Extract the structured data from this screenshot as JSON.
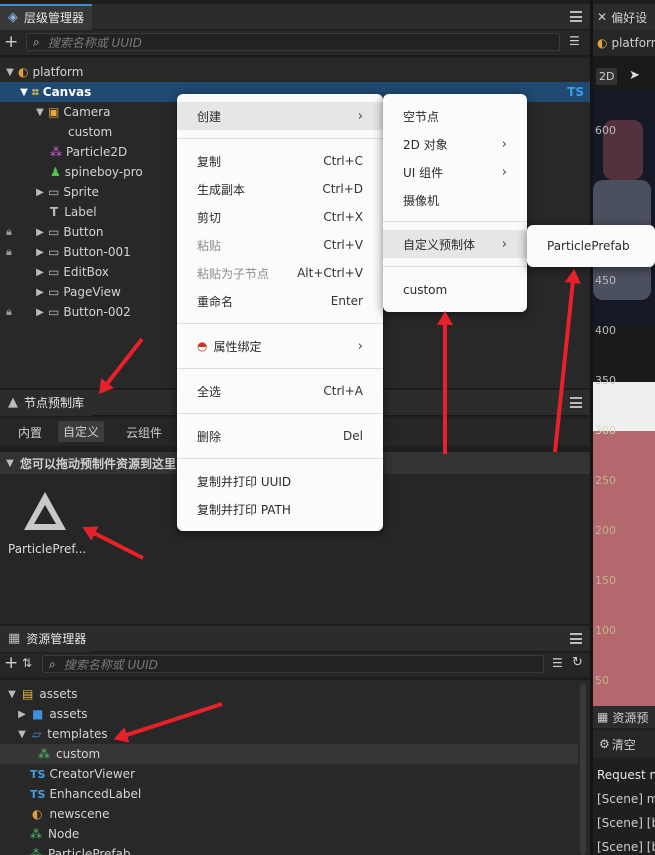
{
  "hierarchy": {
    "title": "层级管理器",
    "search_placeholder": "搜索名称或 UUID",
    "nodes": [
      {
        "label": "platform",
        "icon": "scene-icon"
      },
      {
        "label": "Canvas",
        "badge": "TS"
      },
      {
        "label": "Camera"
      },
      {
        "label": "custom"
      },
      {
        "label": "Particle2D"
      },
      {
        "label": "spineboy-pro"
      },
      {
        "label": "Sprite"
      },
      {
        "label": "Label"
      },
      {
        "label": "Button"
      },
      {
        "label": "Button-001"
      },
      {
        "label": "EditBox"
      },
      {
        "label": "PageView"
      },
      {
        "label": "Button-002"
      }
    ]
  },
  "prefab_lib": {
    "title": "节点预制库",
    "tabs": [
      "内置",
      "自定义",
      "云组件"
    ],
    "active_tab": "自定义",
    "section": "您可以拖动预制件资源到这里",
    "item_label": "ParticlePref..."
  },
  "assets": {
    "title": "资源管理器",
    "search_placeholder": "搜索名称或 UUID",
    "items": [
      {
        "label": "assets"
      },
      {
        "label": "assets"
      },
      {
        "label": "templates"
      },
      {
        "label": "custom"
      },
      {
        "label": "CreatorViewer",
        "prefix": "TS"
      },
      {
        "label": "EnhancedLabel",
        "prefix": "TS"
      },
      {
        "label": "newscene"
      },
      {
        "label": "Node"
      },
      {
        "label": "ParticlePrefab"
      }
    ]
  },
  "right": {
    "pref_tab": "偏好设",
    "scene_tab": "platform",
    "btn_2d": "2D",
    "ruler": [
      "600",
      "450",
      "400",
      "350",
      "300",
      "250",
      "200",
      "150",
      "100",
      "50"
    ],
    "console_title": "资源预",
    "clear_label": "清空",
    "rows": [
      "Request na",
      "[Scene] me",
      "[Scene] [bu",
      "[Scene] [bo"
    ]
  },
  "context_menu": {
    "items": [
      {
        "label": "创建",
        "shortcut": ""
      },
      {
        "label": "复制",
        "shortcut": "Ctrl+C"
      },
      {
        "label": "生成副本",
        "shortcut": "Ctrl+D"
      },
      {
        "label": "剪切",
        "shortcut": "Ctrl+X"
      },
      {
        "label": "粘贴",
        "shortcut": "Ctrl+V"
      },
      {
        "label": "粘贴为子节点",
        "shortcut": "Alt+Ctrl+V"
      },
      {
        "label": "重命名",
        "shortcut": "Enter"
      },
      {
        "label": "属性绑定",
        "shortcut": ""
      },
      {
        "label": "全选",
        "shortcut": "Ctrl+A"
      },
      {
        "label": "删除",
        "shortcut": "Del"
      },
      {
        "label": "复制并打印 UUID",
        "shortcut": ""
      },
      {
        "label": "复制并打印 PATH",
        "shortcut": ""
      }
    ]
  },
  "create_menu": {
    "items": [
      "空节点",
      "2D 对象",
      "UI 组件",
      "摄像机",
      "自定义预制体",
      "custom"
    ]
  },
  "prefab_menu": {
    "items": [
      "ParticlePrefab"
    ]
  },
  "colors": {
    "accent": "#1f4a73",
    "annotation_red": "#e8202a",
    "scene_pink": "#b5676e"
  }
}
